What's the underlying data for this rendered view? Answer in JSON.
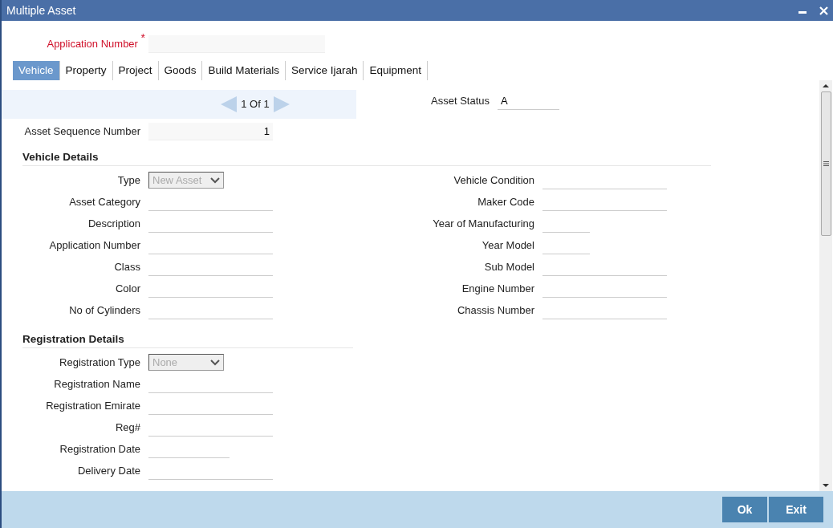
{
  "window": {
    "title": "Multiple Asset"
  },
  "application_number": {
    "label": "Application Number",
    "required_mark": "*"
  },
  "tabs": [
    {
      "label": "Vehicle",
      "selected": true
    },
    {
      "label": "Property",
      "selected": false
    },
    {
      "label": "Project",
      "selected": false
    },
    {
      "label": "Goods",
      "selected": false
    },
    {
      "label": "Build Materials",
      "selected": false
    },
    {
      "label": "Service Ijarah",
      "selected": false
    },
    {
      "label": "Equipment",
      "selected": false
    }
  ],
  "pager": {
    "text": "1 Of 1"
  },
  "asset_status": {
    "label": "Asset Status",
    "value": "A"
  },
  "asset_sequence_number": {
    "label": "Asset Sequence Number",
    "value": "1"
  },
  "sections": [
    {
      "title": "Vehicle Details",
      "left_fields": [
        {
          "label": "Type",
          "kind": "select",
          "value": "New Asset",
          "disabled": true
        },
        {
          "label": "Asset Category",
          "kind": "text"
        },
        {
          "label": "Description",
          "kind": "text"
        },
        {
          "label": "Application Number",
          "kind": "text"
        },
        {
          "label": "Class",
          "kind": "text"
        },
        {
          "label": "Color",
          "kind": "text"
        },
        {
          "label": "No of Cylinders",
          "kind": "text"
        }
      ],
      "right_fields": [
        {
          "label": "Vehicle Condition",
          "kind": "text"
        },
        {
          "label": "Maker Code",
          "kind": "text"
        },
        {
          "label": "Year of Manufacturing",
          "kind": "short"
        },
        {
          "label": "Year Model",
          "kind": "short"
        },
        {
          "label": "Sub Model",
          "kind": "text"
        },
        {
          "label": "Engine Number",
          "kind": "text"
        },
        {
          "label": "Chassis Number",
          "kind": "text"
        }
      ]
    },
    {
      "title": "Registration Details",
      "left_fields": [
        {
          "label": "Registration Type",
          "kind": "select",
          "value": "None",
          "disabled": true
        },
        {
          "label": "Registration Name",
          "kind": "text"
        },
        {
          "label": "Registration Emirate",
          "kind": "text"
        },
        {
          "label": "Reg#",
          "kind": "text"
        },
        {
          "label": "Registration Date",
          "kind": "medium"
        },
        {
          "label": "Delivery Date",
          "kind": "text"
        }
      ]
    }
  ],
  "buttons": [
    {
      "label": "Ok"
    },
    {
      "label": "Exit"
    }
  ]
}
